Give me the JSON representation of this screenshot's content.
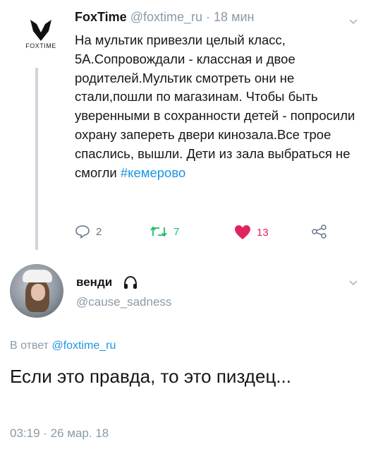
{
  "tweet": {
    "logo_text": "FOXTIME",
    "name": "FoxTime",
    "handle": "@foxtime_ru",
    "dot": "·",
    "time": "18 мин",
    "text": "На мультик привезли целый класс, 5А.Сопровождали - классная и двое родителей.Мультик смотреть они не стали,пошли по магазинам. Чтобы быть уверенными в сохранности детей - попросили охрану запереть двери кинозала.Все трое спаслись, вышли. Дети из зала выбраться не смогли ",
    "hashtag": "#кемерово",
    "actions": {
      "replies": "2",
      "retweets": "7",
      "likes": "13"
    }
  },
  "reply": {
    "name": "венди",
    "handle": "@cause_sadness",
    "replying_prefix": "В ответ ",
    "replying_to": "@foxtime_ru",
    "text": "Если это правда, то это пиздец...",
    "timestamp": "03:19 · 26 мар. 18"
  },
  "colors": {
    "link": "#1b95e0",
    "retweet": "#17bf63",
    "like": "#e0245e",
    "muted": "#8a9aa8"
  }
}
